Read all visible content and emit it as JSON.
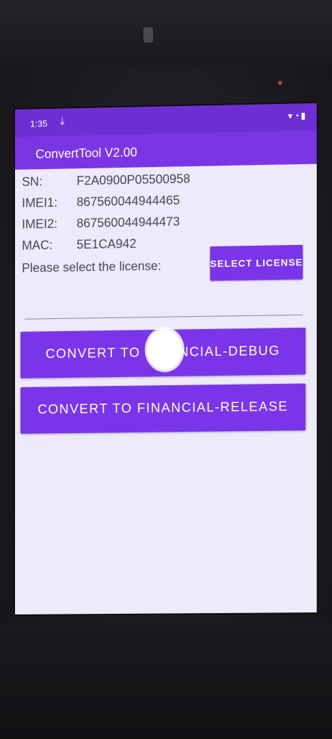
{
  "status_bar": {
    "time": "1:35",
    "download_icon": "download-icon",
    "right_icons": "wifi-icon battery-icon"
  },
  "app": {
    "title": "ConvertTool V2.00"
  },
  "device_info": [
    {
      "label": "SN:",
      "value": "F2A0900P05500958"
    },
    {
      "label": "IMEI1:",
      "value": "867560044944465"
    },
    {
      "label": "IMEI2:",
      "value": "867560044944473"
    },
    {
      "label": "MAC:",
      "value": "5E1CA942"
    }
  ],
  "license": {
    "prompt": "Please select the license:",
    "select_button": "SELECT LICENSE",
    "input_value": ""
  },
  "buttons": {
    "debug": "CONVERT TO FINANCIAL-DEBUG",
    "release": "CONVERT TO FINANCIAL-RELEASE"
  },
  "colors": {
    "accent": "#7a35e8",
    "status_bar": "#6d2fd3",
    "background": "#efeaf9"
  }
}
